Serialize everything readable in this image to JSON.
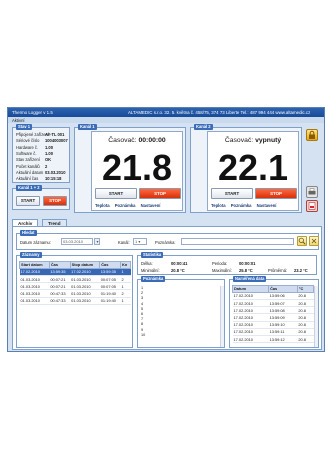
{
  "window": {
    "title": "Thermo Logger v 1.5",
    "company": "ALTAMEDIC s.r.o. 32. 5. května č. 458/75, 374 73 Liberte  Tel.: 487 994 444  www.altamedic.cz",
    "menu": "Aktivní"
  },
  "stav": {
    "label": "Stav 1",
    "rows": [
      {
        "k": "Připojené zařízení",
        "v": "AY-TL 001"
      },
      {
        "k": "Sériové číslo",
        "v": "1004003007"
      },
      {
        "k": "Hardware č.",
        "v": "1.00"
      },
      {
        "k": "Software č.",
        "v": "1.00"
      },
      {
        "k": "Stav zařízení",
        "v": "OK"
      },
      {
        "k": "Počet kanálů",
        "v": "2"
      },
      {
        "k": "Aktuální datum",
        "v": "03.03.2010"
      },
      {
        "k": "Aktuální čas",
        "v": "10:15:18"
      }
    ]
  },
  "kanal12": {
    "label": "Kanál 1 + 2",
    "start": "START",
    "stop": "STOP"
  },
  "kanal1": {
    "label": "Kanál 1",
    "title_prefix": "Časovač:",
    "title_value": "00:00:00",
    "value": "21.8",
    "start": "START",
    "stop": "STOP",
    "links": [
      "Teplota",
      "Poznámka",
      "Nastavení"
    ]
  },
  "kanal2": {
    "label": "Kanál 2",
    "title_prefix": "Časovač:",
    "title_value": "vypnutý",
    "value": "22.1",
    "start": "START",
    "stop": "STOP",
    "links": [
      "Teplota",
      "Poznámka",
      "Nastavení"
    ]
  },
  "tabs": {
    "archiv": "Archiv",
    "trend": "Trend"
  },
  "hledat": {
    "label": "Hledat",
    "datum_label": "Datum záznamu:",
    "datum_value": "03.03.2010",
    "kanal_label": "Kanál:",
    "kanal_value": "1",
    "poznamka_label": "Poznámka:"
  },
  "zaznamy": {
    "label": "Záznamy",
    "headers": [
      "Start datum",
      "Čas",
      "Stop datum",
      "Čas",
      "Kn"
    ],
    "rows": [
      [
        "17.02.2010",
        "13:59:35",
        "17.02.2010",
        "13:59:35",
        "1"
      ],
      [
        "01.03.2010",
        "00:07:21",
        "01.03.2010",
        "00:07:05",
        "2"
      ],
      [
        "01.03.2010",
        "00:07:21",
        "01.03.2010",
        "00:07:05",
        "1"
      ],
      [
        "01.03.2010",
        "00:47:33",
        "01.03.2010",
        "01:19:40",
        "2"
      ],
      [
        "01.03.2010",
        "00:47:33",
        "01.03.2010",
        "01:19:40",
        "1"
      ]
    ]
  },
  "statistika": {
    "label": "Statistika",
    "delka_k": "Délka:",
    "delka_v": "00:00:41",
    "perioda_k": "Perioda:",
    "perioda_v": "00:00:01",
    "min_k": "Minimální:",
    "min_v": "20.8 °C",
    "max_k": "Maximální:",
    "max_v": "25.8 °C",
    "prum_k": "Průměrná:",
    "prum_v": "23.2 °C"
  },
  "poznamka": {
    "label": "Poznámka",
    "lines": [
      "1",
      "2",
      "3",
      "4",
      "5",
      "6",
      "7",
      "8",
      "9",
      "10"
    ]
  },
  "namerena": {
    "label": "Naměřená data",
    "headers": [
      "Datum",
      "Čas",
      "°C"
    ],
    "rows": [
      [
        "17.02.2010",
        "13:59:06",
        "20.8"
      ],
      [
        "17.02.2010",
        "13:59:07",
        "20.8"
      ],
      [
        "17.02.2010",
        "13:59:08",
        "20.8"
      ],
      [
        "17.02.2010",
        "13:59:09",
        "20.8"
      ],
      [
        "17.02.2010",
        "13:59:10",
        "20.8"
      ],
      [
        "17.02.2010",
        "13:59:11",
        "20.8"
      ],
      [
        "17.02.2010",
        "13:59:12",
        "20.8"
      ]
    ]
  },
  "colors": {
    "accent": "#3b6cb8",
    "stop": "#d8300c",
    "panel": "#d4e2f2"
  },
  "icons": [
    "lock-icon",
    "print-icon",
    "export-icon",
    "search-icon",
    "clear-icon"
  ]
}
